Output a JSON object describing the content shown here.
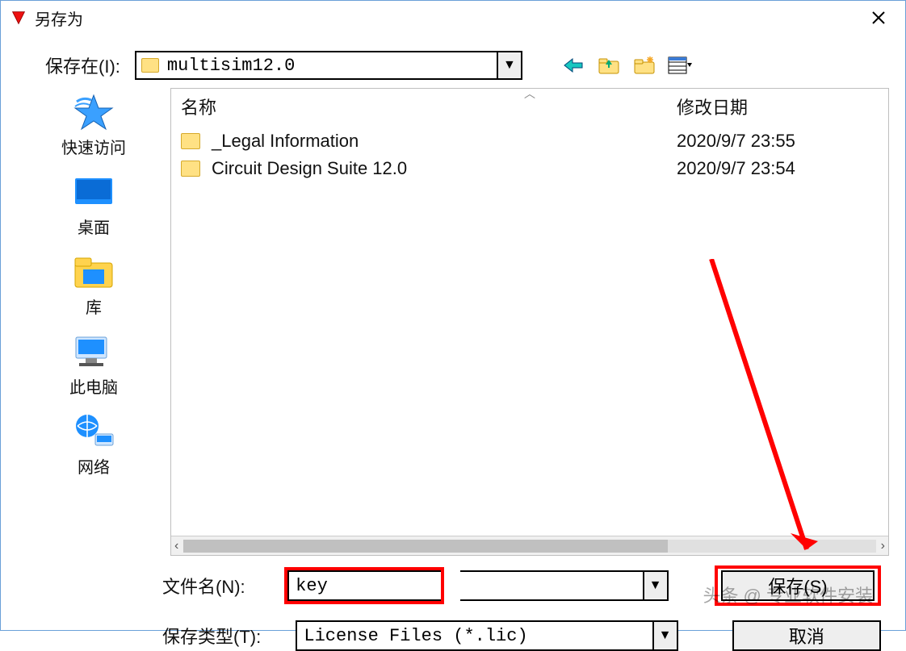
{
  "title": "另存为",
  "savein": {
    "label": "保存在(I):",
    "value": "multisim12.0"
  },
  "places": {
    "quick": "快速访问",
    "desktop": "桌面",
    "libraries": "库",
    "thispc": "此电脑",
    "network": "网络"
  },
  "columns": {
    "name": "名称",
    "modified": "修改日期"
  },
  "rows": [
    {
      "name": "_Legal Information",
      "modified": "2020/9/7 23:55"
    },
    {
      "name": "Circuit Design Suite 12.0",
      "modified": "2020/9/7 23:54"
    }
  ],
  "filename": {
    "label": "文件名(N):",
    "value": "key"
  },
  "filetype": {
    "label": "保存类型(T):",
    "value": "License Files (*.lic)"
  },
  "buttons": {
    "save": "保存(S)",
    "cancel": "取消"
  },
  "watermark": "头条 @ 专业软件安装"
}
